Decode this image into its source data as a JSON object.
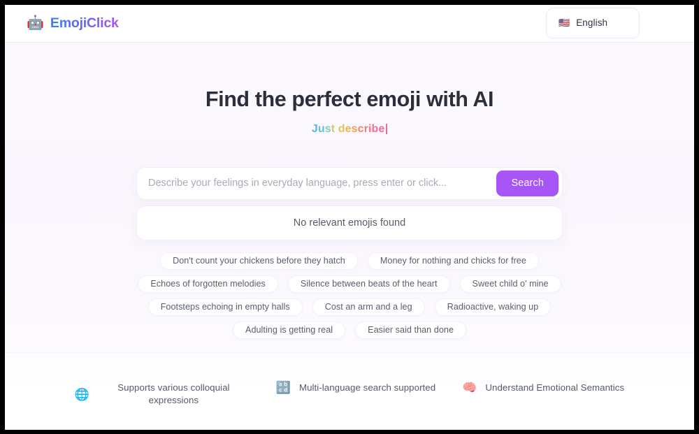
{
  "header": {
    "logo_icon": "robot-emoji",
    "logo_glyph": "🤖",
    "brand_name": "EmojiClick",
    "language": {
      "flag_icon": "us-flag-emoji",
      "flag_glyph": "🇺🇸",
      "label": "English"
    }
  },
  "hero": {
    "title": "Find the perfect emoji with AI",
    "subtitle_text": "Just describe",
    "subtitle_colors": [
      "#5ab4e8",
      "#5fc2d6",
      "#7fd0b4",
      "#c9cf73",
      "#b7b7b7",
      "#e3c35c",
      "#edb35a",
      "#f0a05e",
      "#f08a68",
      "#ef7d77",
      "#f0768a",
      "#f0709a",
      "#ef6d93"
    ],
    "cursor_color": "#f06d90"
  },
  "search": {
    "placeholder": "Describe your feelings in everyday language, press enter or click...",
    "value": "",
    "button_label": "Search",
    "button_color": "#a855f7"
  },
  "results": {
    "message": "No relevant emojis found"
  },
  "suggestions": [
    "Don't count your chickens before they hatch",
    "Money for nothing and chicks for free",
    "Echoes of forgotten melodies",
    "Silence between beats of the heart",
    "Sweet child o' mine",
    "Footsteps echoing in empty halls",
    "Cost an arm and a leg",
    "Radioactive, waking up",
    "Adulting is getting real",
    "Easier said than done"
  ],
  "features": [
    {
      "icon": "globe-with-meridians-icon",
      "glyph": "🌐",
      "text": "Supports various colloquial expressions"
    },
    {
      "icon": "input-latin-letters-icon",
      "glyph": "🔡",
      "text": "Multi-language search supported"
    },
    {
      "icon": "brain-icon",
      "glyph": "🧠",
      "text": "Understand Emotional Semantics"
    }
  ]
}
